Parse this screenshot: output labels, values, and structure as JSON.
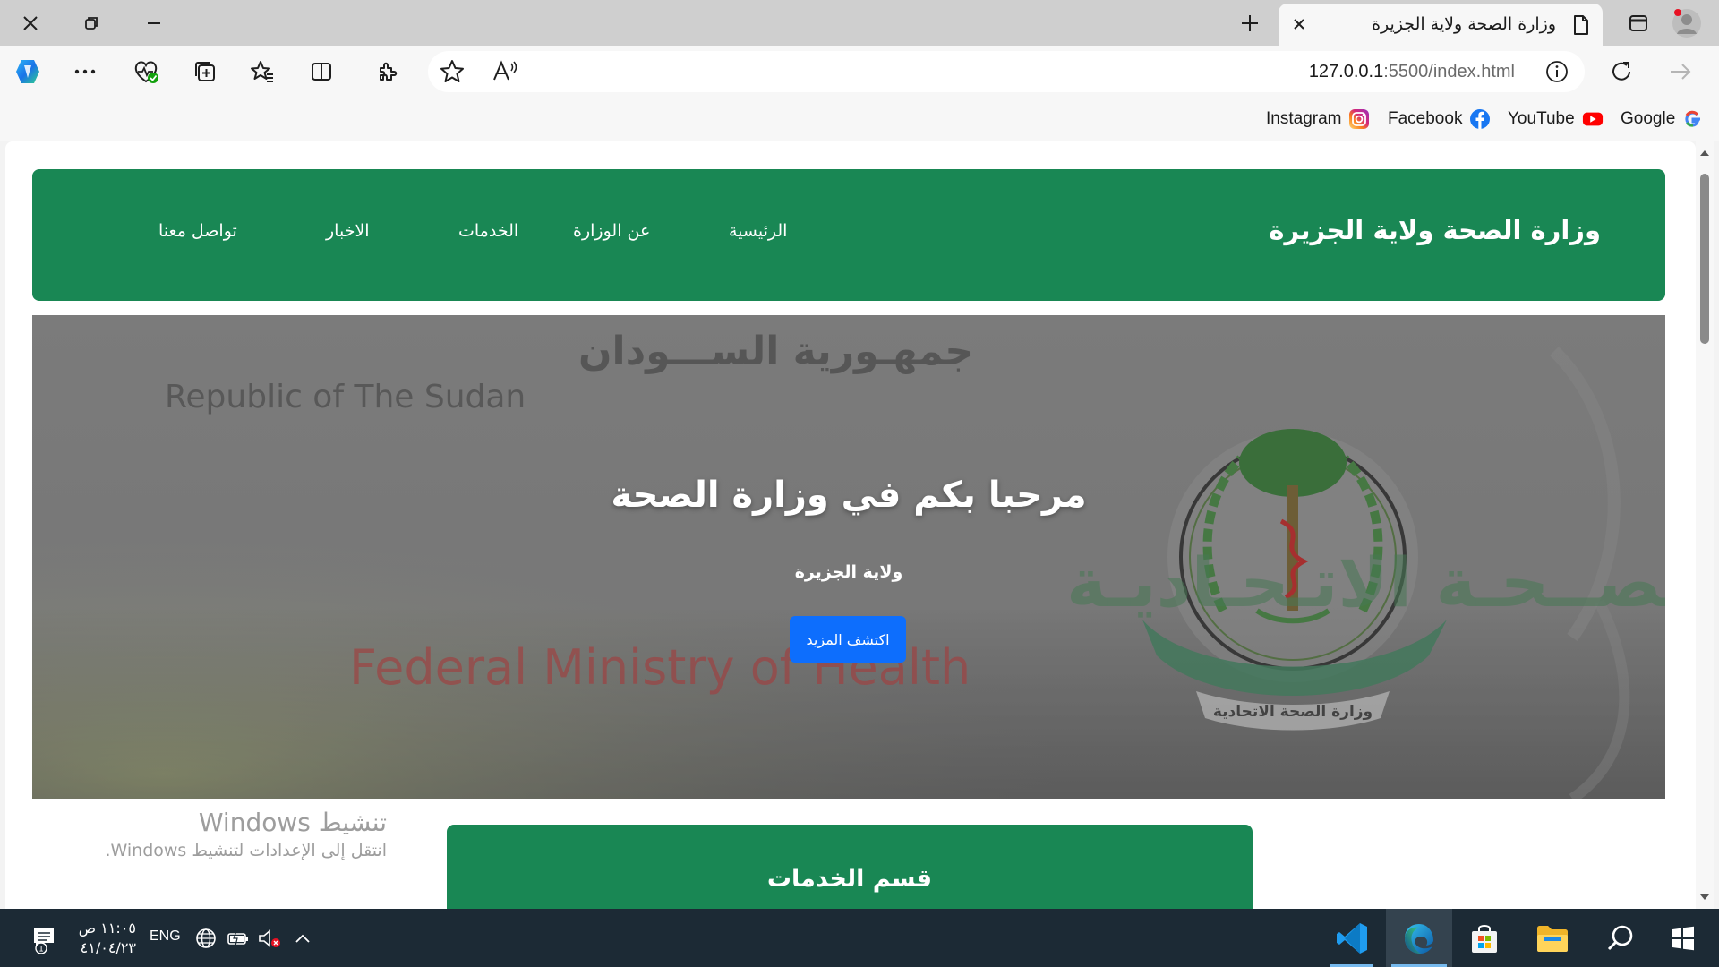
{
  "browser": {
    "tab": {
      "title": "وزارة الصحة ولاية الجزيرة",
      "close_label": "×"
    },
    "address": {
      "url_host": "127.0.0.1",
      "url_path": ":5500/index.html"
    },
    "favorites": [
      {
        "label": "Google",
        "icon": "google-icon"
      },
      {
        "label": "YouTube",
        "icon": "youtube-icon"
      },
      {
        "label": "Facebook",
        "icon": "facebook-icon"
      },
      {
        "label": "Instagram",
        "icon": "instagram-icon"
      }
    ]
  },
  "page": {
    "brand": "وزارة الصحة ولاية الجزيرة",
    "nav": [
      "الرئيسية",
      "عن الوزارة",
      "الخدمات",
      "الاخبار",
      "تواصل معنا"
    ],
    "hero": {
      "bg_logo_text_ar": "جمهـورية الســـودان",
      "bg_logo_text_en": "Republic of The Sudan",
      "bg_ministry_ar": "وزارة الصــحـة الاتـحـاديـة",
      "bg_ministry_en": "Federal Ministry of Health",
      "seal_text": "وزارة الصحة الاتحادية",
      "title": "مرحبا بكم في وزارة الصحة",
      "subtitle": "ولاية الجزيرة",
      "button": "اكتشف المزيد"
    },
    "services_title": "قسم الخدمات"
  },
  "watermark": {
    "title": "تنشيط Windows",
    "subtitle": "انتقل إلى الإعدادات لتنشيط Windows."
  },
  "taskbar": {
    "time": "١١:٠٥ ص",
    "date": "٤١/٠٤/٢٣",
    "language": "ENG",
    "notification_count": "1"
  },
  "colors": {
    "header_green": "#198754",
    "button_blue": "#0d6efd",
    "taskbar": "#1c2a35"
  }
}
